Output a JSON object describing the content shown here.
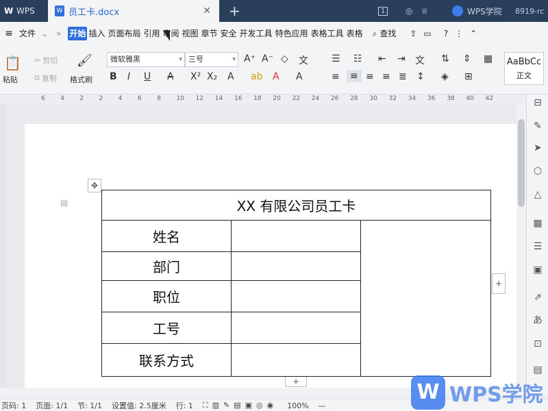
{
  "app": {
    "name": "WPS",
    "document_title": "员工卡.docx",
    "account": "WPS学院",
    "user": "8919-rc",
    "badge": "1"
  },
  "menu": {
    "file": "文件",
    "tabs": [
      "开始",
      "插入",
      "页面布局",
      "引用",
      "审阅",
      "视图",
      "章节",
      "安全",
      "开发工具",
      "特色应用",
      "表格工具",
      "表格"
    ],
    "active": "开始",
    "search": "查找"
  },
  "ribbon": {
    "paste": "粘贴",
    "cut": "剪切",
    "copy": "复制",
    "format_painter": "格式刷",
    "font_name": "微软雅黑",
    "font_size": "三号",
    "style_preview": "AaBbCc",
    "style_name": "正文"
  },
  "ruler": {
    "marks": [
      "6",
      "4",
      "2",
      "2",
      "4",
      "6",
      "8",
      "10",
      "12",
      "14",
      "16",
      "18",
      "20",
      "22",
      "24",
      "26",
      "28",
      "30",
      "32",
      "34",
      "36",
      "38",
      "40",
      "42"
    ]
  },
  "table": {
    "title": "XX 有限公司员工卡",
    "rows": [
      "姓名",
      "部门",
      "职位",
      "工号",
      "联系方式"
    ]
  },
  "status": {
    "page_code": "页码: 1",
    "page": "页面: 1/1",
    "section": "节: 1/1",
    "setting": "设置值: 2.5厘米",
    "line": "行: 1",
    "zoom": "100%"
  },
  "watermark": {
    "logo": "W",
    "text": "WPS学院"
  }
}
